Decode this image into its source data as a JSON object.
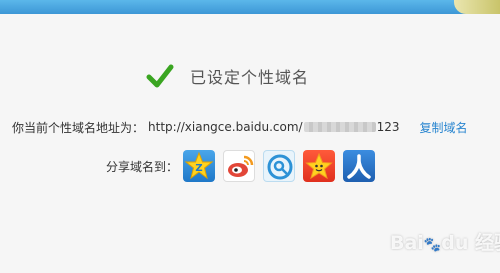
{
  "status": {
    "title": "已设定个性域名",
    "icon": "checkmark-icon"
  },
  "domain": {
    "label": "你当前个性域名地址为：",
    "url_prefix": "http://xiangce.baidu.com/",
    "url_suffix": "123",
    "copy_label": "复制域名"
  },
  "share": {
    "label": "分享域名到：",
    "targets": [
      {
        "icon": "qzone-icon",
        "color": "#1f8ad8"
      },
      {
        "icon": "sina-weibo-icon",
        "color": "#e24638"
      },
      {
        "icon": "tencent-weibo-icon",
        "color": "#2d92d6"
      },
      {
        "icon": "pengyou-icon",
        "color": "#f3a21c"
      },
      {
        "icon": "renren-icon",
        "color": "#1f6cc2"
      }
    ]
  },
  "watermark": {
    "text": "Bai du 经验"
  },
  "colors": {
    "check": "#3aa521",
    "link": "#2a86d0",
    "topbar": "#3d97d6"
  }
}
